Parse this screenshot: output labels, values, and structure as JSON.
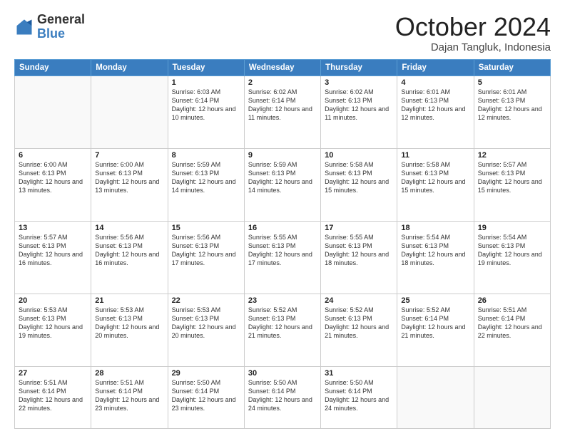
{
  "header": {
    "logo": {
      "general": "General",
      "blue": "Blue"
    },
    "month": "October 2024",
    "location": "Dajan Tangluk, Indonesia"
  },
  "weekdays": [
    "Sunday",
    "Monday",
    "Tuesday",
    "Wednesday",
    "Thursday",
    "Friday",
    "Saturday"
  ],
  "weeks": [
    [
      null,
      null,
      {
        "day": "1",
        "sunrise": "Sunrise: 6:03 AM",
        "sunset": "Sunset: 6:14 PM",
        "daylight": "Daylight: 12 hours and 10 minutes."
      },
      {
        "day": "2",
        "sunrise": "Sunrise: 6:02 AM",
        "sunset": "Sunset: 6:14 PM",
        "daylight": "Daylight: 12 hours and 11 minutes."
      },
      {
        "day": "3",
        "sunrise": "Sunrise: 6:02 AM",
        "sunset": "Sunset: 6:13 PM",
        "daylight": "Daylight: 12 hours and 11 minutes."
      },
      {
        "day": "4",
        "sunrise": "Sunrise: 6:01 AM",
        "sunset": "Sunset: 6:13 PM",
        "daylight": "Daylight: 12 hours and 12 minutes."
      },
      {
        "day": "5",
        "sunrise": "Sunrise: 6:01 AM",
        "sunset": "Sunset: 6:13 PM",
        "daylight": "Daylight: 12 hours and 12 minutes."
      }
    ],
    [
      {
        "day": "6",
        "sunrise": "Sunrise: 6:00 AM",
        "sunset": "Sunset: 6:13 PM",
        "daylight": "Daylight: 12 hours and 13 minutes."
      },
      {
        "day": "7",
        "sunrise": "Sunrise: 6:00 AM",
        "sunset": "Sunset: 6:13 PM",
        "daylight": "Daylight: 12 hours and 13 minutes."
      },
      {
        "day": "8",
        "sunrise": "Sunrise: 5:59 AM",
        "sunset": "Sunset: 6:13 PM",
        "daylight": "Daylight: 12 hours and 14 minutes."
      },
      {
        "day": "9",
        "sunrise": "Sunrise: 5:59 AM",
        "sunset": "Sunset: 6:13 PM",
        "daylight": "Daylight: 12 hours and 14 minutes."
      },
      {
        "day": "10",
        "sunrise": "Sunrise: 5:58 AM",
        "sunset": "Sunset: 6:13 PM",
        "daylight": "Daylight: 12 hours and 15 minutes."
      },
      {
        "day": "11",
        "sunrise": "Sunrise: 5:58 AM",
        "sunset": "Sunset: 6:13 PM",
        "daylight": "Daylight: 12 hours and 15 minutes."
      },
      {
        "day": "12",
        "sunrise": "Sunrise: 5:57 AM",
        "sunset": "Sunset: 6:13 PM",
        "daylight": "Daylight: 12 hours and 15 minutes."
      }
    ],
    [
      {
        "day": "13",
        "sunrise": "Sunrise: 5:57 AM",
        "sunset": "Sunset: 6:13 PM",
        "daylight": "Daylight: 12 hours and 16 minutes."
      },
      {
        "day": "14",
        "sunrise": "Sunrise: 5:56 AM",
        "sunset": "Sunset: 6:13 PM",
        "daylight": "Daylight: 12 hours and 16 minutes."
      },
      {
        "day": "15",
        "sunrise": "Sunrise: 5:56 AM",
        "sunset": "Sunset: 6:13 PM",
        "daylight": "Daylight: 12 hours and 17 minutes."
      },
      {
        "day": "16",
        "sunrise": "Sunrise: 5:55 AM",
        "sunset": "Sunset: 6:13 PM",
        "daylight": "Daylight: 12 hours and 17 minutes."
      },
      {
        "day": "17",
        "sunrise": "Sunrise: 5:55 AM",
        "sunset": "Sunset: 6:13 PM",
        "daylight": "Daylight: 12 hours and 18 minutes."
      },
      {
        "day": "18",
        "sunrise": "Sunrise: 5:54 AM",
        "sunset": "Sunset: 6:13 PM",
        "daylight": "Daylight: 12 hours and 18 minutes."
      },
      {
        "day": "19",
        "sunrise": "Sunrise: 5:54 AM",
        "sunset": "Sunset: 6:13 PM",
        "daylight": "Daylight: 12 hours and 19 minutes."
      }
    ],
    [
      {
        "day": "20",
        "sunrise": "Sunrise: 5:53 AM",
        "sunset": "Sunset: 6:13 PM",
        "daylight": "Daylight: 12 hours and 19 minutes."
      },
      {
        "day": "21",
        "sunrise": "Sunrise: 5:53 AM",
        "sunset": "Sunset: 6:13 PM",
        "daylight": "Daylight: 12 hours and 20 minutes."
      },
      {
        "day": "22",
        "sunrise": "Sunrise: 5:53 AM",
        "sunset": "Sunset: 6:13 PM",
        "daylight": "Daylight: 12 hours and 20 minutes."
      },
      {
        "day": "23",
        "sunrise": "Sunrise: 5:52 AM",
        "sunset": "Sunset: 6:13 PM",
        "daylight": "Daylight: 12 hours and 21 minutes."
      },
      {
        "day": "24",
        "sunrise": "Sunrise: 5:52 AM",
        "sunset": "Sunset: 6:13 PM",
        "daylight": "Daylight: 12 hours and 21 minutes."
      },
      {
        "day": "25",
        "sunrise": "Sunrise: 5:52 AM",
        "sunset": "Sunset: 6:14 PM",
        "daylight": "Daylight: 12 hours and 21 minutes."
      },
      {
        "day": "26",
        "sunrise": "Sunrise: 5:51 AM",
        "sunset": "Sunset: 6:14 PM",
        "daylight": "Daylight: 12 hours and 22 minutes."
      }
    ],
    [
      {
        "day": "27",
        "sunrise": "Sunrise: 5:51 AM",
        "sunset": "Sunset: 6:14 PM",
        "daylight": "Daylight: 12 hours and 22 minutes."
      },
      {
        "day": "28",
        "sunrise": "Sunrise: 5:51 AM",
        "sunset": "Sunset: 6:14 PM",
        "daylight": "Daylight: 12 hours and 23 minutes."
      },
      {
        "day": "29",
        "sunrise": "Sunrise: 5:50 AM",
        "sunset": "Sunset: 6:14 PM",
        "daylight": "Daylight: 12 hours and 23 minutes."
      },
      {
        "day": "30",
        "sunrise": "Sunrise: 5:50 AM",
        "sunset": "Sunset: 6:14 PM",
        "daylight": "Daylight: 12 hours and 24 minutes."
      },
      {
        "day": "31",
        "sunrise": "Sunrise: 5:50 AM",
        "sunset": "Sunset: 6:14 PM",
        "daylight": "Daylight: 12 hours and 24 minutes."
      },
      null,
      null
    ]
  ]
}
